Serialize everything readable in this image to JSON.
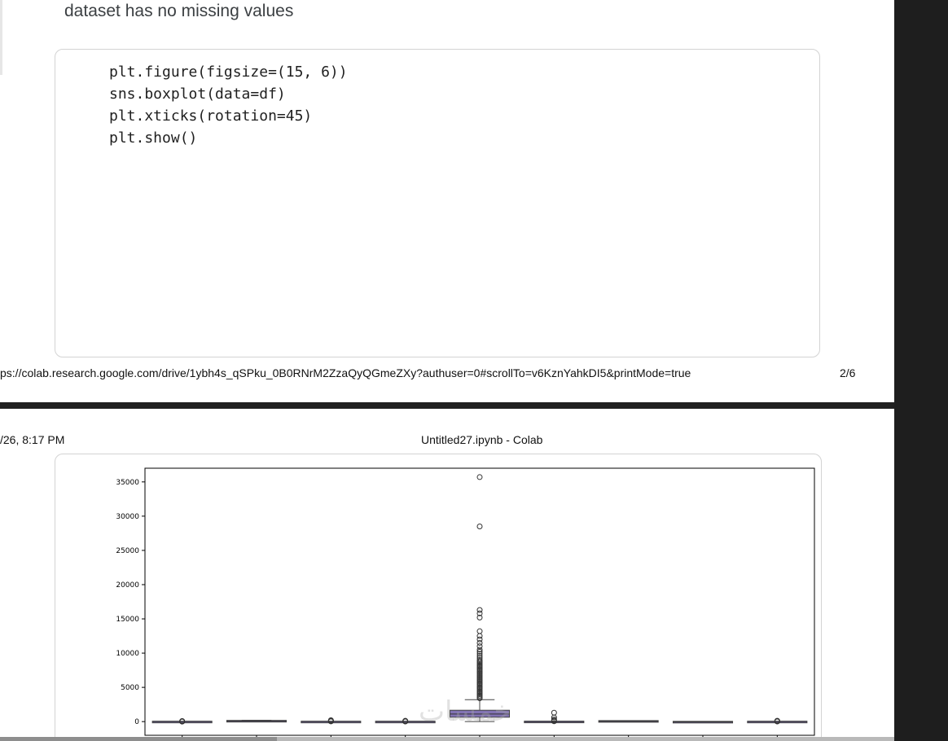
{
  "page1": {
    "markdown_text": "dataset has no missing values",
    "code_lines": [
      "plt.figure(figsize=(15, 6))",
      "sns.boxplot(data=df)",
      "plt.xticks(rotation=45)",
      "plt.show()"
    ],
    "footer_url": "ps://colab.research.google.com/drive/1ybh4s_qSPku_0B0RNrM2ZzaQyQGmeZXy?authuser=0#scrollTo=v6KznYahkDI5&printMode=true",
    "footer_page": "2/6"
  },
  "page2": {
    "header_date": "/26, 8:17 PM",
    "header_title": "Untitled27.ipynb - Colab"
  },
  "watermark_text": "خمسات",
  "chart_data": {
    "type": "box",
    "ylim": [
      -2000,
      37000
    ],
    "yticks": [
      0,
      5000,
      10000,
      15000,
      20000,
      25000,
      30000,
      35000
    ],
    "ytick_labels": [
      "0",
      "5000",
      "10000",
      "15000",
      "20000",
      "25000",
      "30000",
      "35000"
    ],
    "box_color": "#8172b3",
    "series": [
      {
        "q1": 0,
        "median": 0,
        "q3": 0,
        "whisker_low": 0,
        "whisker_high": 0,
        "outliers": [
          0,
          20,
          40,
          60,
          80
        ]
      },
      {
        "q1": 0,
        "median": 50,
        "q3": 120,
        "whisker_low": 0,
        "whisker_high": 200,
        "outliers": []
      },
      {
        "q1": 0,
        "median": 0,
        "q3": 0,
        "whisker_low": 0,
        "whisker_high": 0,
        "outliers": [
          30,
          60,
          100,
          150,
          200
        ]
      },
      {
        "q1": 0,
        "median": 0,
        "q3": 0,
        "whisker_low": 0,
        "whisker_high": 0,
        "outliers": [
          20,
          40,
          80,
          120
        ]
      },
      {
        "q1": 700,
        "median": 1100,
        "q3": 1600,
        "whisker_low": 0,
        "whisker_high": 3200,
        "outliers": [
          3400,
          3600,
          3800,
          4000,
          4200,
          4400,
          4600,
          4800,
          5000,
          5200,
          5400,
          5600,
          5800,
          6000,
          6200,
          6400,
          6600,
          6800,
          7000,
          7200,
          7400,
          7600,
          7800,
          8000,
          8200,
          8400,
          8600,
          8800,
          9000,
          9300,
          9600,
          9900,
          10200,
          10500,
          11000,
          11500,
          12000,
          12500,
          13200,
          15200,
          15800,
          16300,
          28500,
          35700
        ]
      },
      {
        "q1": 0,
        "median": 0,
        "q3": 10,
        "whisker_low": 0,
        "whisker_high": 20,
        "outliers": [
          50,
          150,
          300,
          600,
          1300
        ]
      },
      {
        "q1": 0,
        "median": 40,
        "q3": 90,
        "whisker_low": 0,
        "whisker_high": 130,
        "outliers": []
      },
      {
        "q1": -80,
        "median": -50,
        "q3": -20,
        "whisker_low": -120,
        "whisker_high": 0,
        "outliers": []
      },
      {
        "q1": 0,
        "median": 0,
        "q3": 0,
        "whisker_low": 0,
        "whisker_high": 0,
        "outliers": [
          20,
          50,
          90,
          130
        ]
      }
    ]
  }
}
